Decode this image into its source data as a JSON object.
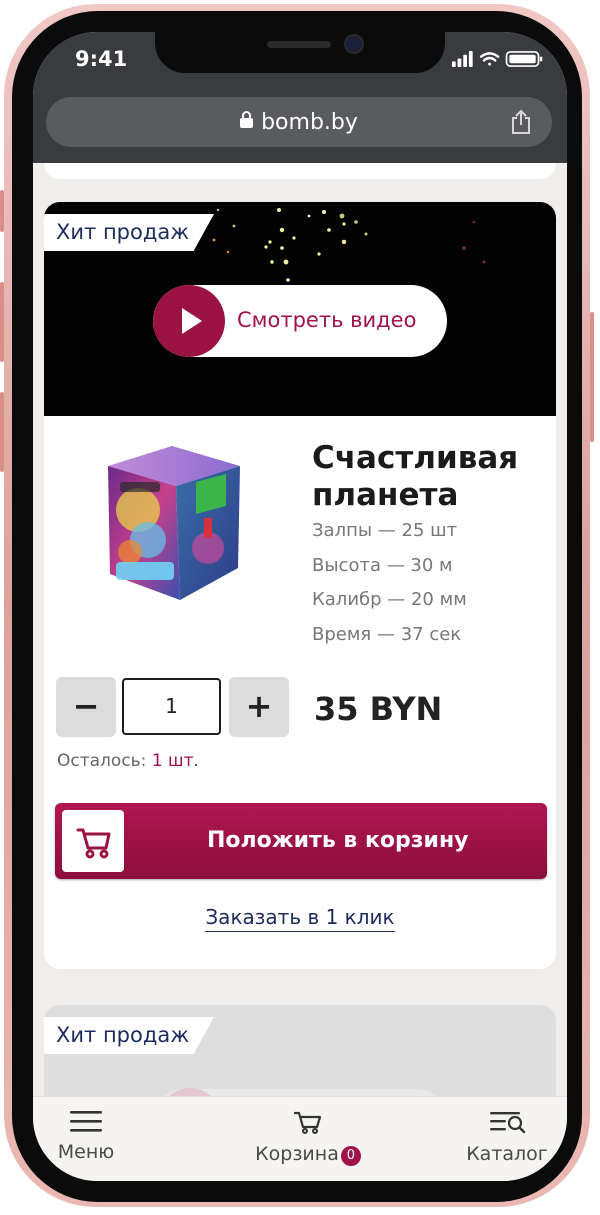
{
  "status_bar": {
    "time": "9:41"
  },
  "browser": {
    "url": "bomb.by"
  },
  "product": {
    "badge": "Хит продаж",
    "video_button": "Смотреть видео",
    "title": "Счастливая планета",
    "specs": [
      "Залпы — 25 шт",
      "Высота — 30 м",
      "Калибр — 20 мм",
      "Время — 37 сек"
    ],
    "quantity": "1",
    "minus_label": "−",
    "plus_label": "+",
    "price": "35 BYN",
    "remaining_label": "Осталось:",
    "remaining_value": "1 шт.",
    "add_to_cart": "Положить в корзину",
    "one_click": "Заказать в 1 клик"
  },
  "next_product": {
    "badge": "Хит продаж"
  },
  "tabbar": {
    "menu": "Меню",
    "cart": "Корзина",
    "cart_count": "0",
    "catalog": "Каталог"
  },
  "colors": {
    "brand": "#a0124a",
    "navy": "#1e2b5e"
  }
}
